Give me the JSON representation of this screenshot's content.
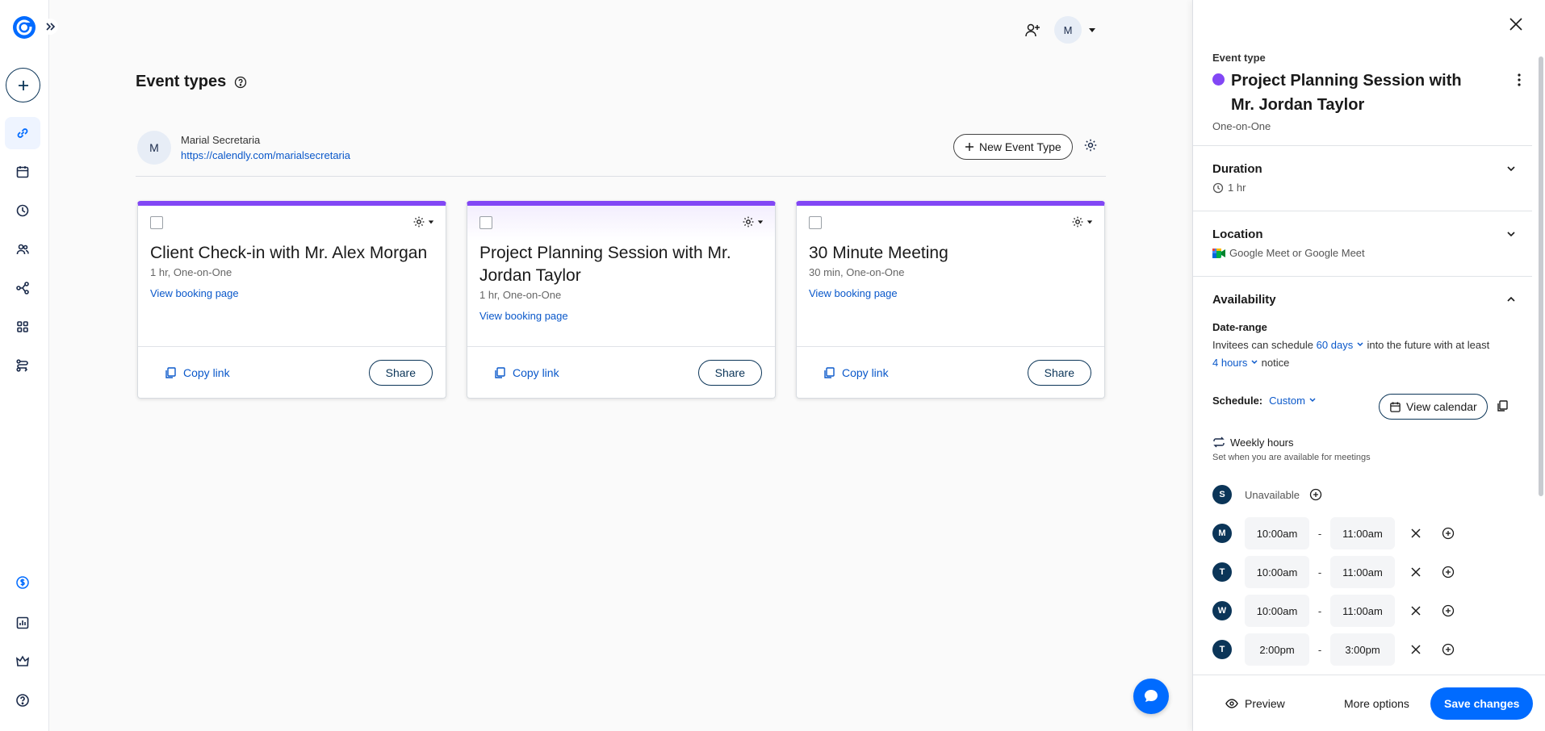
{
  "colors": {
    "accent": "#006bff",
    "event_purple": "#8247f5",
    "navy": "#0b3558"
  },
  "rail": {
    "icons": [
      "calendly-logo",
      "expand-icon",
      "plus-icon",
      "link-icon",
      "calendar-icon",
      "clock-icon",
      "people-icon",
      "workflow-icon",
      "apps-icon",
      "routing-icon",
      "dollar-icon",
      "analytics-icon",
      "crown-icon",
      "help-icon"
    ]
  },
  "header": {
    "avatar_initial": "M"
  },
  "main": {
    "title": "Event types",
    "user": {
      "initial": "M",
      "name": "Marial Secretaria",
      "link": "https://calendly.com/marialsecretaria"
    },
    "new_event_label": "New Event Type",
    "cards": [
      {
        "title": "Client Check-in with Mr. Alex Morgan",
        "sub": "1 hr, One-on-One",
        "view": "View booking page",
        "copy": "Copy link",
        "share": "Share"
      },
      {
        "title": "Project Planning Session with Mr. Jordan Taylor",
        "sub": "1 hr, One-on-One",
        "view": "View booking page",
        "copy": "Copy link",
        "share": "Share"
      },
      {
        "title": "30 Minute Meeting",
        "sub": "30 min, One-on-One",
        "view": "View booking page",
        "copy": "Copy link",
        "share": "Share"
      }
    ]
  },
  "panel": {
    "event_type_label": "Event type",
    "title": "Project Planning Session with Mr. Jordan Taylor",
    "kind": "One-on-One",
    "duration": {
      "label": "Duration",
      "value": "1 hr"
    },
    "location": {
      "label": "Location",
      "value": "Google Meet or Google Meet"
    },
    "availability": {
      "label": "Availability",
      "date_range_label": "Date-range",
      "text1": "Invitees can schedule",
      "days_value": "60 days",
      "text2": "into the future with at least",
      "hours_value": "4 hours",
      "text3": "notice",
      "schedule_label": "Schedule:",
      "schedule_value": "Custom",
      "view_calendar": "View calendar",
      "weekly_label": "Weekly hours",
      "weekly_sub": "Set when you are available for meetings",
      "unavailable": "Unavailable",
      "days": [
        {
          "letter": "S",
          "unavailable": true
        },
        {
          "letter": "M",
          "start": "10:00am",
          "end": "11:00am"
        },
        {
          "letter": "T",
          "start": "10:00am",
          "end": "11:00am"
        },
        {
          "letter": "W",
          "start": "10:00am",
          "end": "11:00am"
        },
        {
          "letter": "T",
          "start": "2:00pm",
          "end": "3:00pm"
        }
      ],
      "dash": "-"
    },
    "footer": {
      "preview": "Preview",
      "more": "More options",
      "save": "Save changes"
    }
  }
}
